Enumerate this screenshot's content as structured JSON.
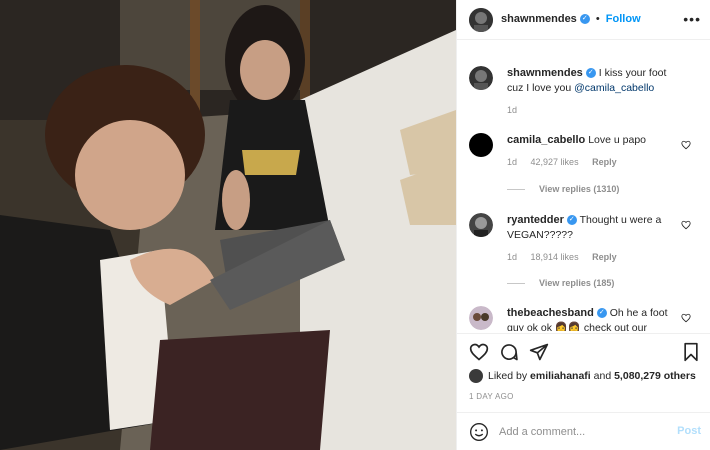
{
  "post": {
    "username": "shawnmendes",
    "follow_label": "Follow",
    "separator": "•",
    "more_icon": "more-options-icon"
  },
  "caption": {
    "username": "shawnmendes",
    "text": "I kiss your foot cuz I love you ",
    "mention": "@camila_cabello",
    "age": "1d"
  },
  "comments": [
    {
      "username": "camila_cabello",
      "verified": false,
      "text": "Love u papo",
      "age": "1d",
      "likes": "42,927 likes",
      "reply_label": "Reply",
      "view_replies": "View replies (1310)"
    },
    {
      "username": "ryantedder",
      "verified": true,
      "text": "Thought u were a VEGAN?????",
      "age": "1d",
      "likes": "18,914 likes",
      "reply_label": "Reply",
      "view_replies": "View replies (185)"
    },
    {
      "username": "thebeachesband",
      "verified": true,
      "text": "Oh he a foot guy ok ok 👩👩 check out our"
    }
  ],
  "likes": {
    "prefix": "Liked by ",
    "user": "emiliahanafi",
    "and": " and ",
    "count": "5,080,279 others"
  },
  "timestamp": "1 DAY AGO",
  "add_comment": {
    "placeholder": "Add a comment...",
    "post_label": "Post"
  },
  "colors": {
    "accent": "#0095f6",
    "verified": "#3897f0",
    "muted": "#8e8e8e"
  },
  "icons": [
    "heart-icon",
    "comment-icon",
    "share-icon",
    "bookmark-icon",
    "smile-icon",
    "verified-icon"
  ]
}
